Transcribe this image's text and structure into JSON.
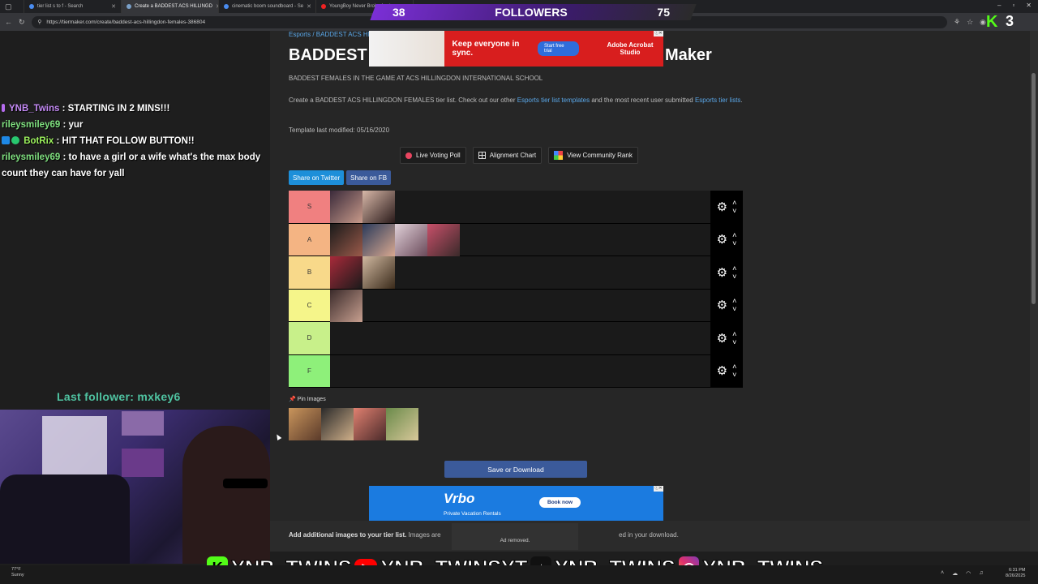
{
  "browser": {
    "tabs": [
      {
        "label": "tier list s to f - Search",
        "active": false,
        "favicon": "search"
      },
      {
        "label": "Create a BADDEST ACS HILLINGD",
        "active": true,
        "favicon": "tiermaker"
      },
      {
        "label": "cinematic boom soundboard - Se",
        "active": false,
        "favicon": "search"
      },
      {
        "label": "YoungBoy Never Broke Again",
        "active": false,
        "favicon": "youtube"
      }
    ],
    "url": "https://tiermaker.com/create/baddest-acs-hillingdon-females-386804"
  },
  "overlay": {
    "followers_current": "38",
    "followers_label": "FOLLOWERS",
    "followers_goal": "75",
    "kick_count": "3",
    "kick_letter": "K",
    "last_follower": "Last follower: mxkey6"
  },
  "chat": [
    {
      "user": "YNB_Twins",
      "message": " : STARTING IN 2 MINS!!!",
      "color": "#c48af5",
      "badges": [
        "sub"
      ]
    },
    {
      "user": "rileysmiley69",
      "message": " : yur",
      "color": "#7fe07f",
      "badges": []
    },
    {
      "user": "BotRix",
      "message": " : HIT THAT FOLLOW BUTTON!!",
      "color": "#9bf05c",
      "badges": [
        "mod",
        "verified"
      ]
    },
    {
      "user": "rileysmiley69",
      "message": " : to have a girl or a wife what's the max body count they can have for yall",
      "color": "#7fe07f",
      "badges": []
    }
  ],
  "page": {
    "breadcrumb": "Esports / BADDEST ACS HILLIN",
    "title_left": "BADDEST",
    "title_right": "Maker",
    "subtitle": "BADDEST FEMALES IN THE GAME AT ACS HILLINGDON INTERNATIONAL SCHOOL",
    "desc_1": "Create a BADDEST ACS HILLINGDON FEMALES tier list. Check out our other ",
    "desc_link_1": "Esports tier list templates",
    "desc_2": " and the most recent user submitted ",
    "desc_link_2": "Esports tier lists",
    "desc_3": ".",
    "modified": "Template last modified: 05/16/2020",
    "modes": {
      "live_voting": "Live Voting Poll",
      "alignment": "Alignment Chart",
      "community": "View Community Rank"
    },
    "share_twitter": "Share on Twitter",
    "share_fb": "Share on FB",
    "tiers": [
      {
        "label": "S",
        "color": "#f08080",
        "items": 2
      },
      {
        "label": "A",
        "color": "#f4b483",
        "items": 4
      },
      {
        "label": "B",
        "color": "#f8d98a",
        "items": 2
      },
      {
        "label": "C",
        "color": "#f5f58a",
        "items": 1
      },
      {
        "label": "D",
        "color": "#c8f08a",
        "items": 0
      },
      {
        "label": "F",
        "color": "#8ef07a",
        "items": 0
      }
    ],
    "pin_images": "Pin Images",
    "save_download": "Save or Download",
    "footer_bold": "Add additional images to your tier list.",
    "footer_text": " Images are",
    "footer_tail": "ed in your download.",
    "ad_removed": "Ad removed."
  },
  "ads": {
    "top_copy": "Keep everyone in sync.",
    "top_cta": "Start free trial",
    "top_brand": "Adobe Acrobat Studio",
    "bottom_logo": "Vrbo",
    "bottom_tag": "Private Vacation Rentals",
    "bottom_cta": "Book now"
  },
  "socials": {
    "kick": "YNB_TWINS",
    "youtube": "YNB_TWINSYT",
    "tiktok": "YNB_TWINS",
    "instagram": "YNB_TWINS"
  },
  "taskbar": {
    "temp": "77°F",
    "weather": "Sunny",
    "time": "6:31 PM",
    "date": "8/26/2025"
  }
}
